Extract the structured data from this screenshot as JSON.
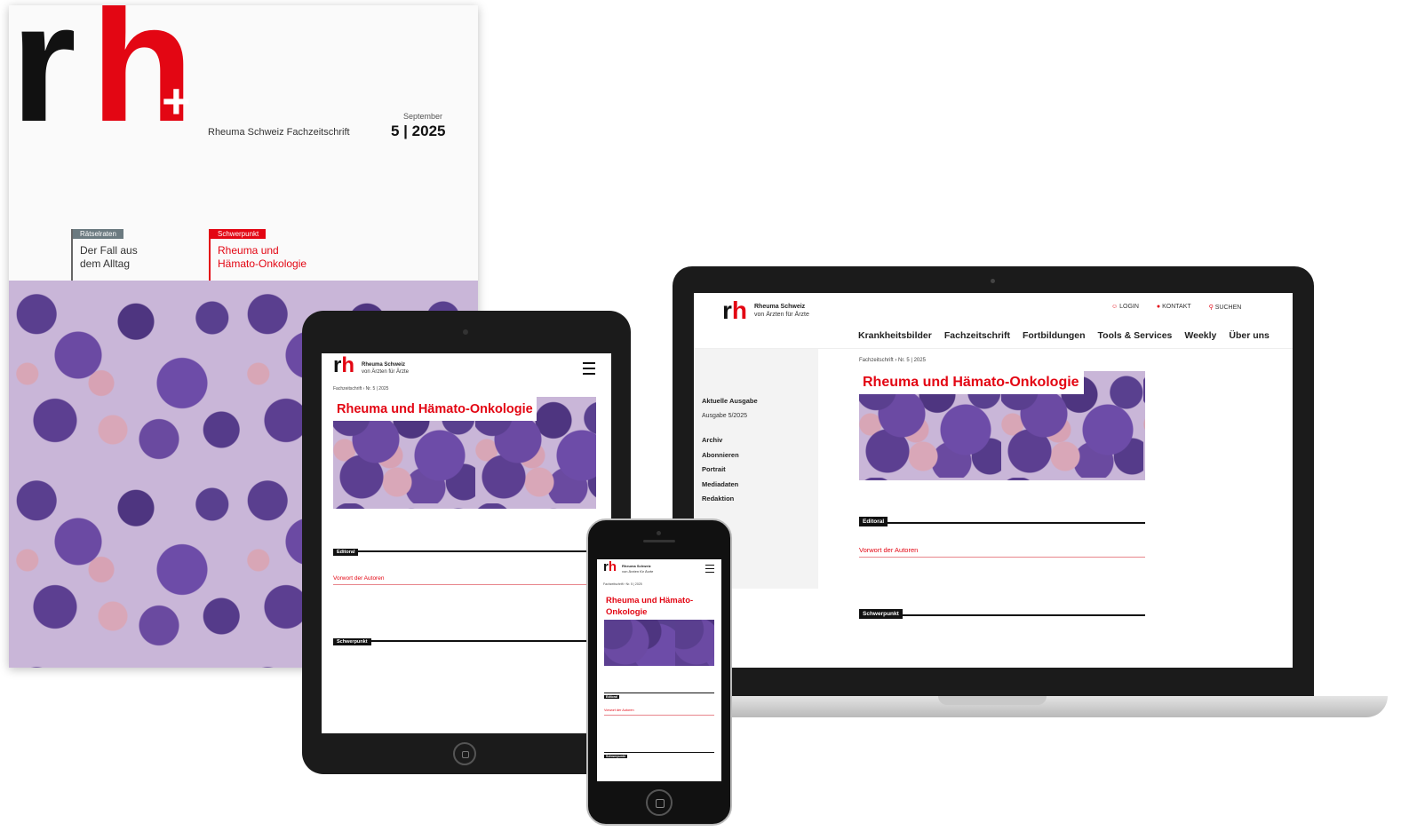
{
  "magazine": {
    "logo_r": "r",
    "logo_h": "h",
    "logo_plus": "+",
    "subtitle": "Rheuma Schweiz Fachzeitschrift",
    "month": "September",
    "issue": "5 | 2025",
    "teaser_left_tag": "Rätselraten",
    "teaser_left_title": "Der Fall aus dem Alltag",
    "teaser_right_tag": "Schwerpunkt",
    "teaser_right_title": "Rheuma und Hämato-Onkologie"
  },
  "site": {
    "brand_name": "Rheuma Schweiz",
    "brand_tagline": "von Ärzten für Ärzte",
    "breadcrumb": "Fachzeitschrift › Nr. 5 | 2025",
    "hero_title": "Rheuma und Hämato-Onkologie",
    "section_editorial": "Editoral",
    "editorial_link": "Vorwort der Autoren",
    "section_focus": "Schwerpunkt"
  },
  "laptop": {
    "top_links": [
      "LOGIN",
      "KONTAKT",
      "SUCHEN"
    ],
    "nav": [
      "Krankheitsbilder",
      "Fachzeitschrift",
      "Fortbildungen",
      "Tools & Services",
      "Weekly",
      "Über uns"
    ],
    "sidebar": {
      "current_heading": "Aktuelle Ausgabe",
      "current_issue": "Ausgabe 5/2025",
      "links": [
        "Archiv",
        "Abonnieren",
        "Portrait",
        "Mediadaten",
        "Redaktion"
      ]
    }
  },
  "colors": {
    "accent": "#e30613",
    "dark": "#111111",
    "cell_bg": "#c9b6d8"
  }
}
